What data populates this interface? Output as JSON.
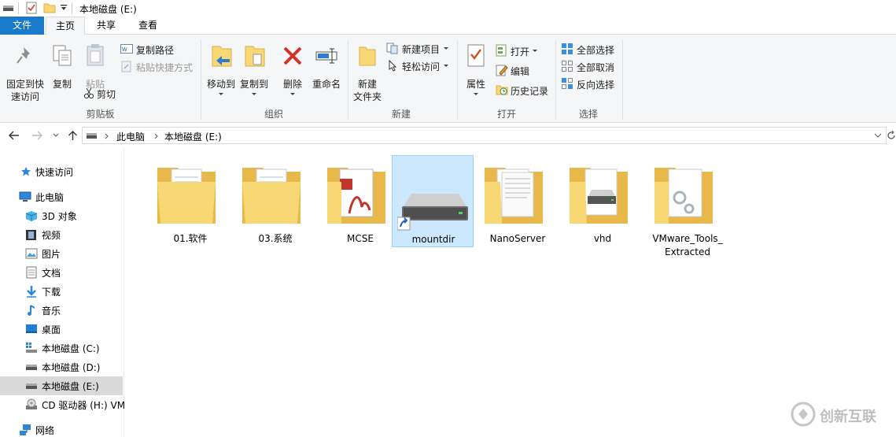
{
  "window": {
    "title": "本地磁盘 (E:)"
  },
  "tabs": [
    {
      "label": "文件"
    },
    {
      "label": "主页"
    },
    {
      "label": "共享"
    },
    {
      "label": "查看"
    }
  ],
  "ribbon": {
    "clipboard": {
      "group_label": "剪贴板",
      "pin_label_1": "固定到快",
      "pin_label_2": "速访问",
      "copy_label": "复制",
      "paste_label": "粘贴",
      "copy_path_label": "复制路径",
      "paste_shortcut_label": "粘贴快捷方式",
      "cut_label": "剪切"
    },
    "organize": {
      "group_label": "组织",
      "move_to_label": "移动到",
      "copy_to_label": "复制到",
      "delete_label": "删除",
      "rename_label": "重命名"
    },
    "new": {
      "group_label": "新建",
      "new_folder_label_1": "新建",
      "new_folder_label_2": "文件夹",
      "new_item_label": "新建项目",
      "easy_access_label": "轻松访问"
    },
    "open": {
      "group_label": "打开",
      "properties_label": "属性",
      "open_label": "打开",
      "edit_label": "编辑",
      "history_label": "历史记录"
    },
    "select": {
      "group_label": "选择",
      "select_all_label": "全部选择",
      "select_none_label": "全部取消",
      "invert_label": "反向选择"
    }
  },
  "address": {
    "crumbs": [
      "此电脑",
      "本地磁盘 (E:)"
    ]
  },
  "sidebar": {
    "items": [
      {
        "label": "快速访问",
        "icon": "star-icon"
      },
      {
        "label": "此电脑",
        "icon": "computer-icon"
      },
      {
        "label": "3D 对象",
        "icon": "cube-icon"
      },
      {
        "label": "视频",
        "icon": "video-icon"
      },
      {
        "label": "图片",
        "icon": "picture-icon"
      },
      {
        "label": "文档",
        "icon": "document-icon"
      },
      {
        "label": "下载",
        "icon": "download-icon"
      },
      {
        "label": "音乐",
        "icon": "music-icon"
      },
      {
        "label": "桌面",
        "icon": "desktop-icon"
      },
      {
        "label": "本地磁盘 (C:)",
        "icon": "windows-drive-icon"
      },
      {
        "label": "本地磁盘 (D:)",
        "icon": "drive-icon"
      },
      {
        "label": "本地磁盘 (E:)",
        "icon": "drive-icon"
      },
      {
        "label": "CD 驱动器 (H:) VM",
        "icon": "cd-drive-icon"
      },
      {
        "label": "网络",
        "icon": "network-icon"
      }
    ]
  },
  "files": [
    {
      "name": "01.软件",
      "type": "folder-with-documents"
    },
    {
      "name": "03.系统",
      "type": "folder-with-documents"
    },
    {
      "name": "MCSE",
      "type": "folder-with-pdf"
    },
    {
      "name": "mountdir",
      "type": "drive-shortcut"
    },
    {
      "name": "NanoServer",
      "type": "folder-with-documents"
    },
    {
      "name": "vhd",
      "type": "folder-with-drive"
    },
    {
      "name": "VMware_Tools_\nExtracted",
      "type": "folder-with-gears"
    }
  ],
  "watermark": {
    "text": "创新互联"
  },
  "colors": {
    "file_tab": "#1979ca",
    "ribbon_bg": "#f5f6f7",
    "selection_bg": "#cce8ff",
    "selection_border": "#99d1ff",
    "folder": "#f8d775"
  }
}
